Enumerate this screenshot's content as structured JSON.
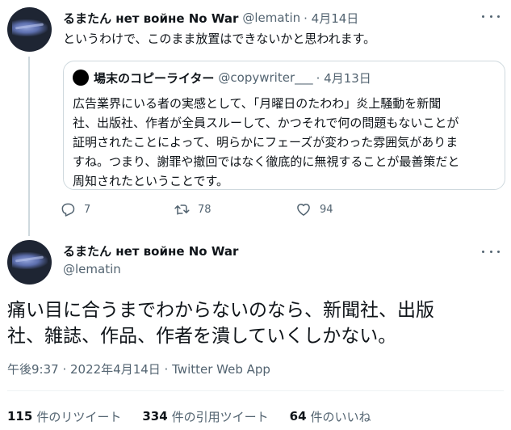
{
  "parent_tweet": {
    "display_name": "るまたん нет войне No War",
    "handle": "@lematin",
    "date": "· 4月14日",
    "text": "というわけで、このまま放置はできないかと思われます。",
    "quote": {
      "display_name": "場末のコピーライター",
      "handle": "@copywriter___",
      "date": "· 4月13日",
      "lines": [
        "広告業界にいる者の実感として、「月曜日のたわわ」炎上騒動を新聞",
        "社、出版社、作者が全員スルーして、かつそれで何の問題もないことが",
        "証明されたことによって、明らかにフェーズが変わった雰囲気がありま",
        "すね。つまり、謝罪や撤回ではなく徹底的に無視することが最善策だと",
        "周知されたということです。"
      ]
    },
    "actions": {
      "reply_count": "7",
      "retweet_count": "78",
      "like_count": "94"
    }
  },
  "main_tweet": {
    "display_name": "るまたん нет войне No War",
    "handle": "@lematin",
    "text_lines": [
      "痛い目に合うまでわからないのなら、新聞社、出版",
      "社、雑誌、作品、作者を潰していくしかない。"
    ],
    "timestamp": "午後9:37 · 2022年4月14日 ·",
    "source_app": "Twitter Web App",
    "stats": {
      "retweets_count": "115",
      "retweets_label": "件のリツイート",
      "quotes_count": "334",
      "quotes_label": "件の引用ツイート",
      "likes_count": "64",
      "likes_label": "件のいいね"
    }
  },
  "colors": {
    "text": "#0f1419",
    "muted": "#536471",
    "border": "#cfd9de"
  }
}
